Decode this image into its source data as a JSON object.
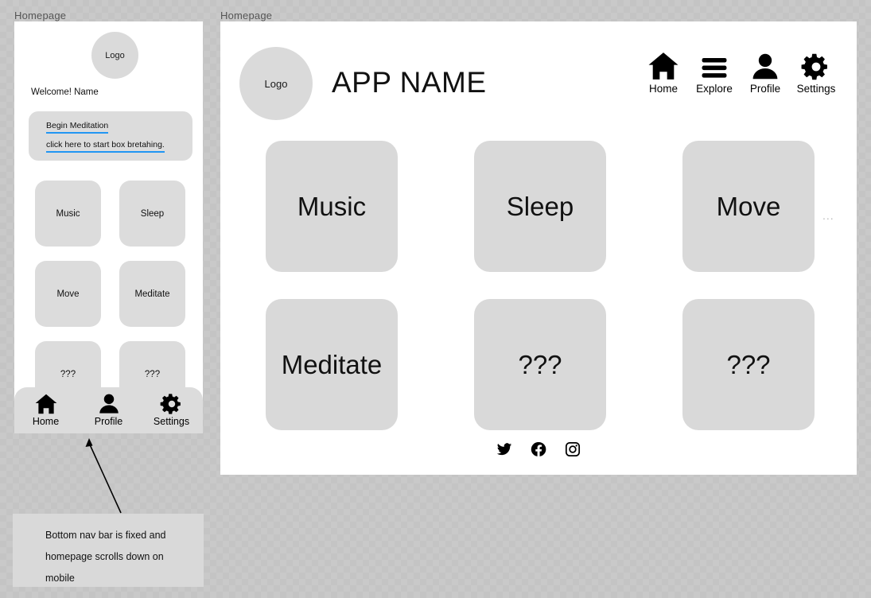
{
  "frames": {
    "mobile_label": "Homepage",
    "desktop_label": "Homepage"
  },
  "mobile": {
    "logo_text": "Logo",
    "welcome_text": "Welcome! Name",
    "meditation_card": {
      "link_title": "Begin Meditation",
      "link_subtitle": "click here to start box bretahing.",
      "link_color": "#2196f3"
    },
    "tiles": [
      {
        "label": "Music"
      },
      {
        "label": "Sleep"
      },
      {
        "label": "Move"
      },
      {
        "label": "Meditate"
      },
      {
        "label": "???"
      },
      {
        "label": "???"
      }
    ],
    "nav": [
      {
        "label": "Home",
        "icon": "home-icon"
      },
      {
        "label": "Profile",
        "icon": "person-icon"
      },
      {
        "label": "Settings",
        "icon": "gear-icon"
      }
    ]
  },
  "desktop": {
    "logo_text": "Logo",
    "app_name": "APP NAME",
    "nav": [
      {
        "label": "Home",
        "icon": "home-icon"
      },
      {
        "label": "Explore",
        "icon": "hamburger-menu-icon"
      },
      {
        "label": "Profile",
        "icon": "person-icon"
      },
      {
        "label": "Settings",
        "icon": "gear-icon"
      }
    ],
    "tiles": [
      {
        "label": "Music"
      },
      {
        "label": "Sleep"
      },
      {
        "label": "Move"
      },
      {
        "label": "Meditate"
      },
      {
        "label": "???"
      },
      {
        "label": "???"
      }
    ],
    "overflow_marker": "...",
    "social": [
      {
        "name": "twitter-icon"
      },
      {
        "name": "facebook-icon"
      },
      {
        "name": "instagram-icon"
      }
    ]
  },
  "annotation": {
    "line1": "Bottom nav bar is fixed and",
    "line2": "homepage scrolls down on",
    "line3": "mobile"
  },
  "colors": {
    "canvas_bg": "#c9c9c9",
    "frame_bg": "#ffffff",
    "tile_bg": "#d9d9d9",
    "link_blue": "#2196f3",
    "label_gray": "#555555"
  }
}
